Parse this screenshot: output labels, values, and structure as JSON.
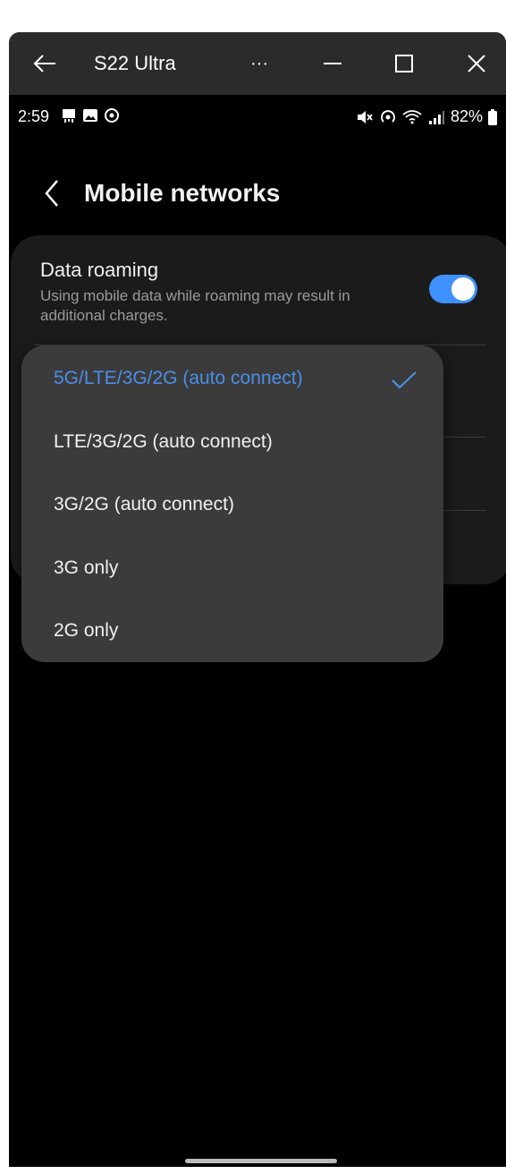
{
  "window": {
    "title": "S22 Ultra",
    "more_label": "···"
  },
  "status_bar": {
    "time": "2:59",
    "battery": "82%"
  },
  "header": {
    "title": "Mobile networks"
  },
  "data_roaming": {
    "title": "Data roaming",
    "subtitle": "Using mobile data while roaming may result in additional charges.",
    "enabled": true
  },
  "network_mode_menu": {
    "selected_index": 0,
    "options": [
      "5G/LTE/3G/2G (auto connect)",
      "LTE/3G/2G (auto connect)",
      "3G/2G (auto connect)",
      "3G only",
      "2G only"
    ]
  },
  "colors": {
    "accent": "#4a8fe8",
    "toggle_on": "#3e91ff",
    "background": "#000000",
    "card": "#1b1b1b",
    "menu": "#3b3b3b"
  }
}
